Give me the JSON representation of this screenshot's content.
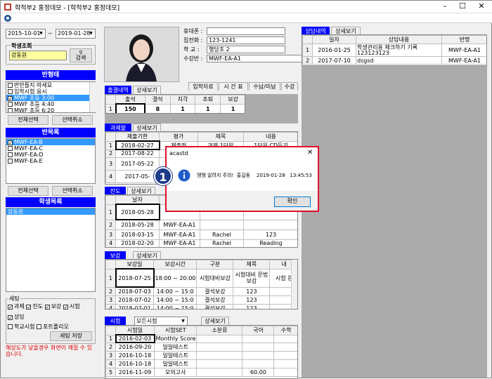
{
  "window": {
    "title": "학적부2 홍정데모 - [학적부2 홍정데모]",
    "minimize": "–",
    "maximize": "☐",
    "close": "✕"
  },
  "dates": {
    "from": "2015-10-01",
    "sep": "~",
    "to": "2019-01-28"
  },
  "student_search": {
    "label": "학생조회",
    "value": "강동원",
    "button": "검색"
  },
  "class_type": {
    "header": "반형태",
    "items": [
      {
        "label": "반만들지 마세요",
        "checked": false,
        "selected": false
      },
      {
        "label": "입학시험 응시",
        "checked": false,
        "selected": false
      },
      {
        "label": "MWF 초등 3:00",
        "checked": true,
        "selected": true
      },
      {
        "label": "MWF 초등 4:40",
        "checked": false,
        "selected": false
      },
      {
        "label": "MWF 초등 6:20",
        "checked": false,
        "selected": false
      }
    ],
    "select_all": "전체선택",
    "deselect": "선택취소"
  },
  "class_list": {
    "header": "반목록",
    "items": [
      {
        "label": "MWF-EA-B",
        "checked": true,
        "selected": true
      },
      {
        "label": "MWF-EA-C",
        "checked": false,
        "selected": false
      },
      {
        "label": "MWF-EA-D",
        "checked": false,
        "selected": false
      },
      {
        "label": "MWF-EA-E",
        "checked": false,
        "selected": false
      }
    ],
    "select_all": "전체선택",
    "deselect": "선택취소"
  },
  "student_list": {
    "header": "학생목록",
    "items": [
      "강동원"
    ]
  },
  "settings": {
    "title": "세팅",
    "row1": [
      {
        "label": "과제",
        "checked": true
      },
      {
        "label": "진도",
        "checked": true
      },
      {
        "label": "보강",
        "checked": true
      },
      {
        "label": "시험",
        "checked": true
      }
    ],
    "row2": [
      {
        "label": "상담",
        "checked": true
      }
    ],
    "row3": [
      {
        "label": "학교시험",
        "checked": false
      },
      {
        "label": "포트폴리오",
        "checked": false
      }
    ],
    "save": "세팅 저장",
    "warning": "해상도가 낮을경우 화면이 깨질 수 있습니다."
  },
  "profile": {
    "phone_label": "휴대폰 :",
    "phone": "",
    "home_label": "집전화 :",
    "home": "123-1241",
    "school_label": "학  교 :",
    "school": "행당초 2",
    "class_label": "수강반 :",
    "class": "MWF-EA-A1"
  },
  "top_tabs": [
    "입학자료",
    "시 간 표",
    "수납/미납",
    "수강"
  ],
  "attendance": {
    "tabs": [
      "출결내역",
      "상세보기"
    ],
    "headers": [
      "출석",
      "결석",
      "지각",
      "조퇴",
      "보강"
    ],
    "row": [
      "1",
      "150",
      "8",
      "1",
      "1",
      "1"
    ]
  },
  "homework": {
    "tabs": [
      "과제물",
      "상세보기"
    ],
    "headers": [
      "제출기한",
      "평가",
      "제목",
      "내용"
    ],
    "rows": [
      [
        "1",
        "2018-02-27",
        "제출전",
        "과제 1단원",
        "1단원 CD듣기"
      ],
      [
        "2",
        "2017-08-22",
        "",
        "",
        ""
      ],
      [
        "3",
        "2017-05-22",
        "",
        "",
        ""
      ],
      [
        "4",
        "2017-05-",
        "",
        "",
        ""
      ]
    ]
  },
  "progress": {
    "tabs": [
      "진도",
      "상세보기"
    ],
    "headers": [
      "날자",
      "",
      "",
      ""
    ],
    "rows": [
      [
        "1",
        "2018-05-28",
        "",
        "",
        ""
      ],
      [
        "2",
        "2018-05-28",
        "MWF-EA-A1",
        "",
        ""
      ],
      [
        "3",
        "2018-03-15",
        "MWF-EA-A1",
        "Rachel",
        "123"
      ],
      [
        "4",
        "2018-02-20",
        "MWF-EA-A1",
        "Rachel",
        "Reading"
      ]
    ]
  },
  "makeup": {
    "tabs": [
      "보강",
      "상세보기"
    ],
    "headers": [
      "보강일",
      "보강시간",
      "구분",
      "제목",
      "내"
    ],
    "rows": [
      [
        "1",
        "2018-07-25",
        "18:00 ~ 20:00",
        "시험대비보강",
        "시험대비 문법 보강",
        "시험 원"
      ],
      [
        "2",
        "2018-07-03",
        "14:00 ~ 15:0",
        "결석보강",
        "123",
        ""
      ],
      [
        "3",
        "2018-07-02",
        "14:00 ~ 15:0",
        "결석보강",
        "123",
        ""
      ],
      [
        "4",
        "2018-07-01",
        "14:00 ~ 15:0",
        "결석보강",
        "123",
        ""
      ]
    ]
  },
  "exam": {
    "label": "시험",
    "filter": "모든시험",
    "detail": "상세보기",
    "headers": [
      "시험일",
      "시험SET",
      "소분류",
      "국어",
      "수학"
    ],
    "rows": [
      [
        "1",
        "2016-02-03",
        "Monthly Score",
        "",
        "",
        ""
      ],
      [
        "2",
        "2016-09-20",
        "일일테스트",
        "",
        "",
        ""
      ],
      [
        "3",
        "2016-10-18",
        "일일테스트",
        "",
        "",
        ""
      ],
      [
        "4",
        "2016-10-18",
        "일일테스트",
        "",
        "",
        ""
      ],
      [
        "5",
        "2016-11-09",
        "모의고사",
        "",
        "60.00",
        ""
      ]
    ]
  },
  "counsel": {
    "tabs": [
      "상담내역",
      "상세보기"
    ],
    "headers": [
      "일자",
      "상담내용",
      "반명"
    ],
    "rows": [
      [
        "1",
        "2016-01-25",
        "학생관리용 체크하기 기록 123123123",
        "MWF-EA-A1"
      ],
      [
        "2",
        "2017-07-10",
        "dsgsd",
        "MWF-EA-A1"
      ]
    ]
  },
  "dialog": {
    "title": "acastd",
    "close": "✕",
    "message": "땡땡 알려지 주의!  홍길동    2019-01-28   13:45:53",
    "ok": "확인",
    "step_number": "1"
  },
  "colors": {
    "accent": "#0000ff",
    "dialog_border": "#e0102a",
    "badge": "#1e3a8a"
  }
}
